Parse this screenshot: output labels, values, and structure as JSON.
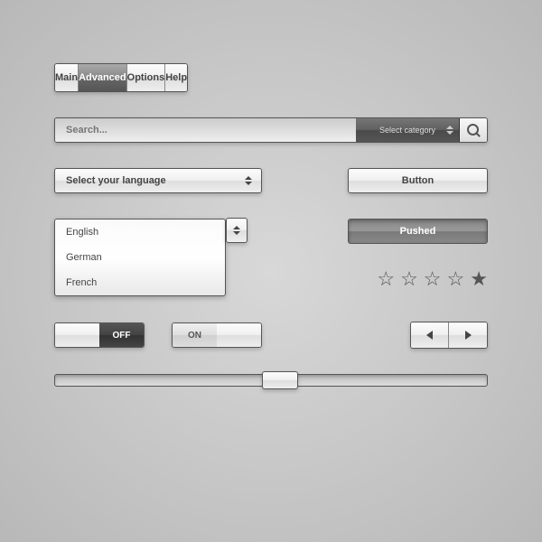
{
  "tabs": [
    {
      "label": "Main"
    },
    {
      "label": "Advanced"
    },
    {
      "label": "Options"
    },
    {
      "label": "Help"
    }
  ],
  "active_tab": 1,
  "search": {
    "placeholder": "Search...",
    "category_label": "Select category"
  },
  "language_dropdown": {
    "label": "Select your language",
    "options": [
      "English",
      "German",
      "French"
    ]
  },
  "buttons": {
    "normal": "Button",
    "pushed": "Pushed"
  },
  "rating": {
    "value": 1,
    "max": 5
  },
  "toggles": {
    "off_label": "OFF",
    "on_label": "ON"
  },
  "slider": {
    "value": 50
  }
}
